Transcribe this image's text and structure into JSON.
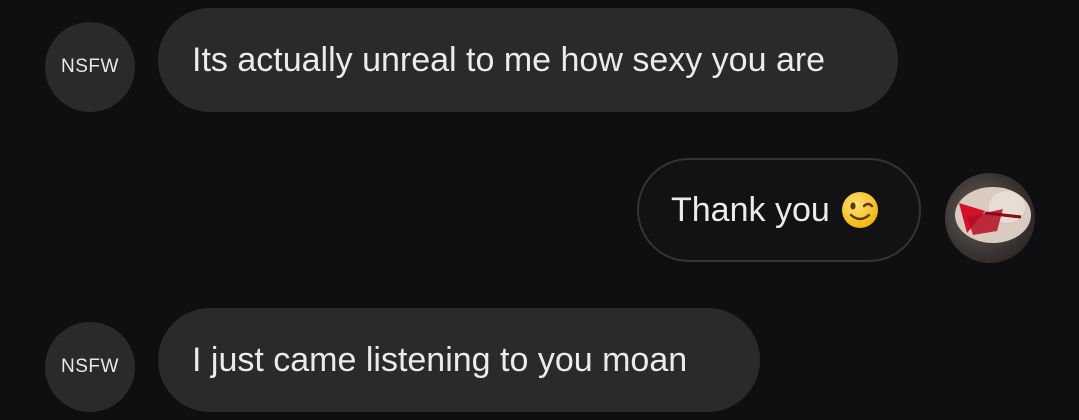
{
  "messages": [
    {
      "sender": "other",
      "avatar_label": "NSFW",
      "text": "Its actually unreal to me how sexy you are"
    },
    {
      "sender": "self",
      "text": "Thank you",
      "emoji": "winking-face-emoji"
    },
    {
      "sender": "other",
      "avatar_label": "NSFW",
      "text": "I just came listening to you moan"
    }
  ],
  "colors": {
    "background": "#0f0e11",
    "incoming_bubble": "#2a292c",
    "outgoing_border": "#343336",
    "text": "#ebebeb"
  }
}
